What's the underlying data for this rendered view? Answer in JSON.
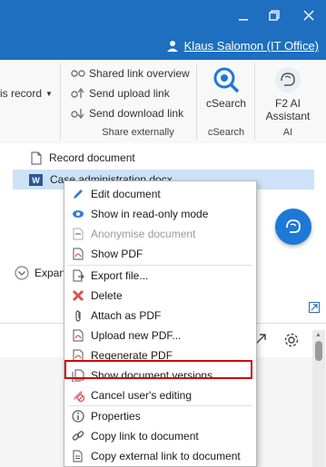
{
  "titlebar": {
    "user_name": "Klaus Salomon (IT Office)"
  },
  "ribbon": {
    "partial_label": "is record",
    "items": [
      {
        "label": "Shared link overview"
      },
      {
        "label": "Send upload link"
      },
      {
        "label": "Send download link"
      }
    ],
    "group_share": "Share externally",
    "csearch_label": "cSearch",
    "csearch_group": "cSearch",
    "ai_label_1": "F2 AI",
    "ai_label_2": "Assistant",
    "ai_group": "AI"
  },
  "tree": {
    "record_label": "Record document",
    "file_label": "Case administration.docx",
    "expand_label": "Expand"
  },
  "menu": {
    "items": [
      {
        "label": "Edit document",
        "icon": "pencil-icon"
      },
      {
        "label": "Show in read-only mode",
        "icon": "eye-icon"
      },
      {
        "label": "Anonymise document",
        "icon": "anonymise-icon",
        "disabled": true
      },
      {
        "label": "Show PDF",
        "icon": "pdf-icon"
      },
      {
        "label": "Export file...",
        "icon": "export-icon"
      },
      {
        "label": "Delete",
        "icon": "delete-icon"
      },
      {
        "label": "Attach as PDF",
        "icon": "paperclip-icon"
      },
      {
        "label": "Upload new PDF...",
        "icon": "upload-pdf-icon"
      },
      {
        "label": "Regenerate PDF",
        "icon": "regenerate-pdf-icon"
      },
      {
        "label": "Show document versions",
        "icon": "versions-icon"
      },
      {
        "label": "Cancel user's editing",
        "icon": "cancel-edit-icon"
      },
      {
        "label": "Properties",
        "icon": "info-icon"
      },
      {
        "label": "Copy link to document",
        "icon": "link-icon"
      },
      {
        "label": "Copy external link to document",
        "icon": "external-link-icon"
      }
    ]
  },
  "colors": {
    "accent": "#1e6fc0",
    "highlight": "#d60000",
    "selected_row": "#cde2f6"
  }
}
